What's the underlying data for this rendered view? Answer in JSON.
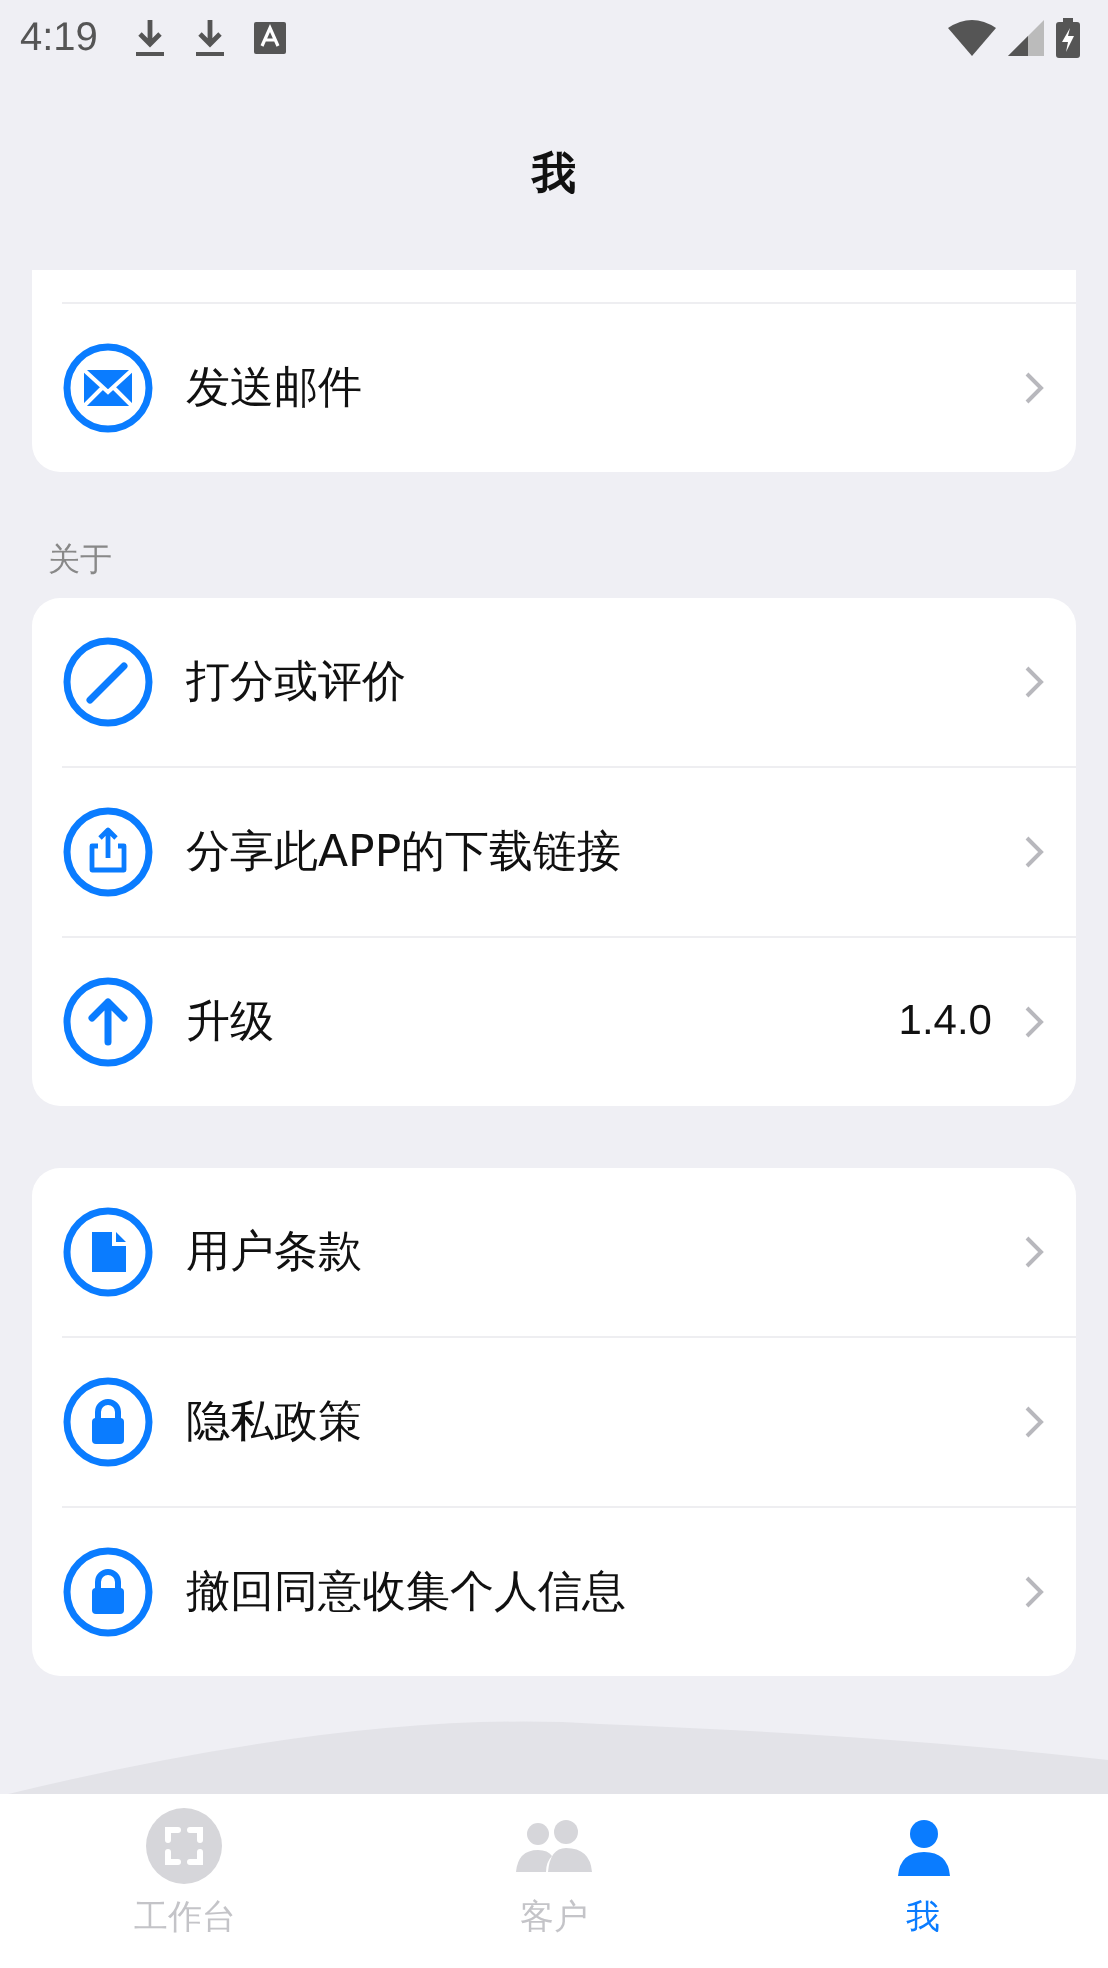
{
  "status_bar": {
    "time": "4:19"
  },
  "header": {
    "title": "我"
  },
  "groups": [
    {
      "items": [
        {
          "kind": "mail",
          "label": "发送邮件"
        }
      ]
    },
    {
      "label": "关于",
      "items": [
        {
          "kind": "pencil",
          "label": "打分或评价"
        },
        {
          "kind": "share",
          "label": "分享此APP的下载链接"
        },
        {
          "kind": "upgrade",
          "label": "升级",
          "value": "1.4.0"
        }
      ]
    },
    {
      "items": [
        {
          "kind": "document",
          "label": "用户条款"
        },
        {
          "kind": "lock",
          "label": "隐私政策"
        },
        {
          "kind": "lock",
          "label": "撤回同意收集个人信息"
        }
      ]
    }
  ],
  "tabs": [
    {
      "kind": "scan",
      "label": "工作台",
      "selected": false
    },
    {
      "kind": "people",
      "label": "客户",
      "selected": false
    },
    {
      "kind": "person",
      "label": "我",
      "selected": true
    }
  ]
}
